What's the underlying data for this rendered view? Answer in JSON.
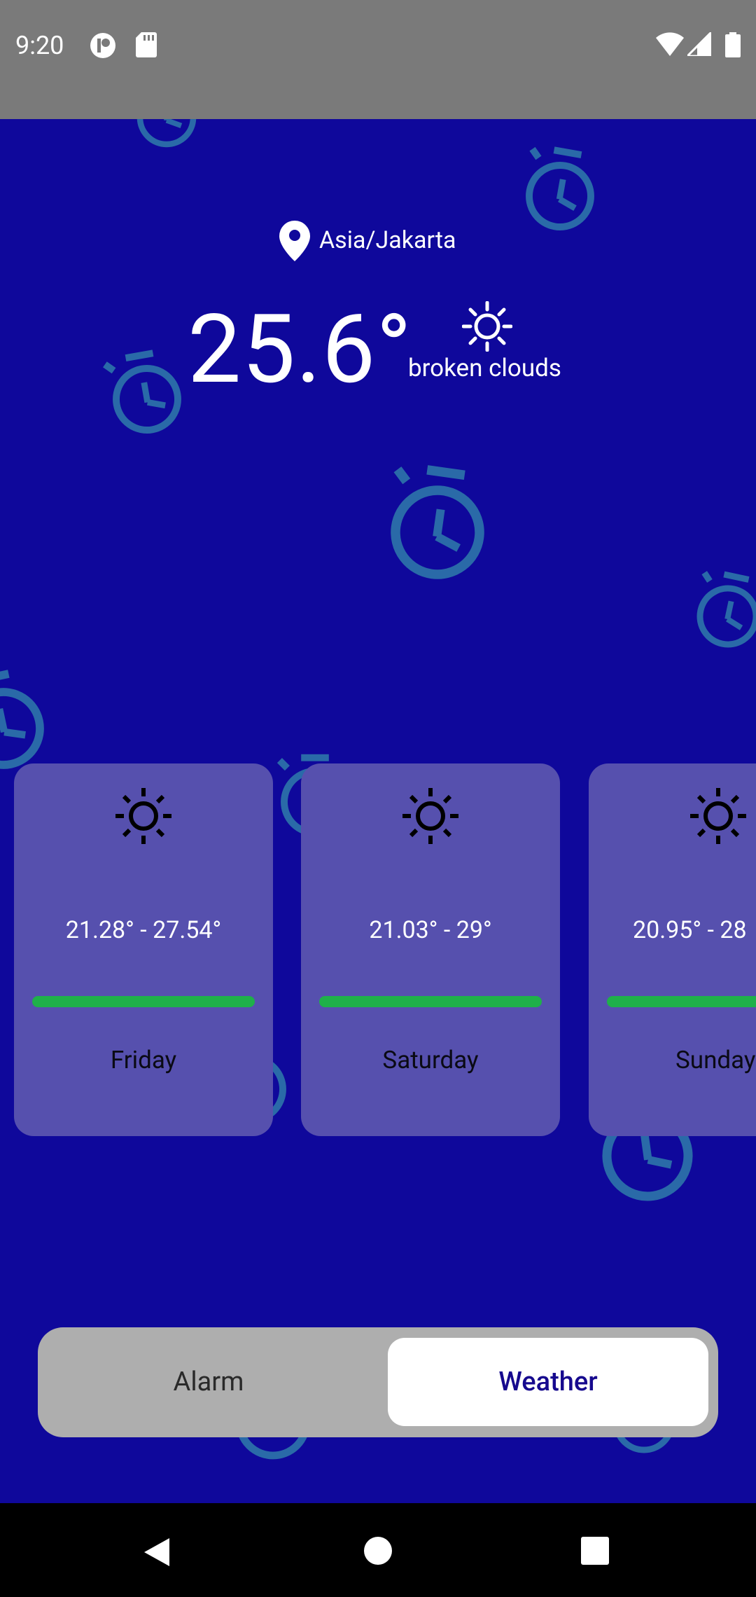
{
  "status_bar": {
    "time": "9:20",
    "icons": [
      "notification-icon",
      "sd-card-icon",
      "wifi-icon",
      "signal-icon",
      "battery-icon"
    ]
  },
  "weather": {
    "location": "Asia/Jakarta",
    "temperature": "25.6°",
    "condition": "broken clouds",
    "condition_icon": "sun-icon"
  },
  "forecast": [
    {
      "range": "21.28° - 27.54°",
      "day": "Friday",
      "icon": "sun-icon",
      "bar_color": "#1fb04a"
    },
    {
      "range": "21.03° - 29°",
      "day": "Saturday",
      "icon": "sun-icon",
      "bar_color": "#1fb04a"
    },
    {
      "range": "20.95° - 28",
      "day": "Sunday",
      "icon": "sun-icon",
      "bar_color": "#1fb04a"
    }
  ],
  "toggle": {
    "alarm_label": "Alarm",
    "weather_label": "Weather",
    "selected": "Weather"
  },
  "nav": {
    "back": "back-icon",
    "home": "home-icon",
    "recents": "recents-icon"
  },
  "colors": {
    "background": "#0f089b",
    "card": "#5650ae",
    "accent_bar": "#1fb04a",
    "deco_clock": "#2a6aa8"
  }
}
